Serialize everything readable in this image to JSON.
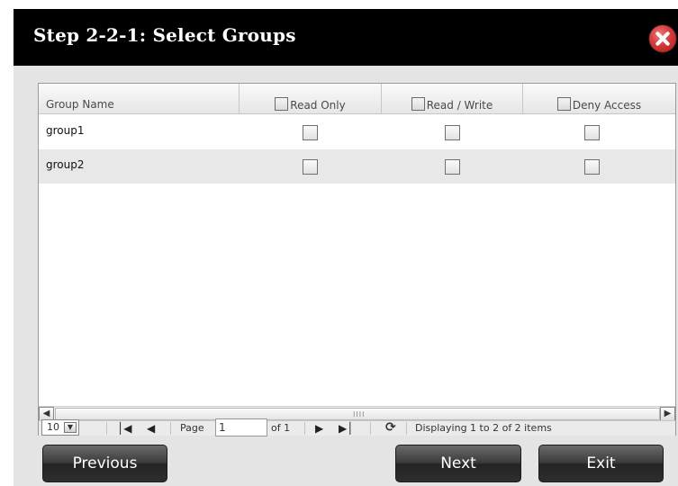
{
  "dialog": {
    "title": "Step 2-2-1: Select Groups"
  },
  "grid": {
    "columns": [
      "Group Name",
      "Read Only",
      "Read / Write",
      "Deny Access"
    ],
    "rows": [
      {
        "name": "group1",
        "read_only": false,
        "read_write": false,
        "deny_access": false
      },
      {
        "name": "group2",
        "read_only": false,
        "read_write": false,
        "deny_access": false
      }
    ],
    "scroll_grip": "IIII"
  },
  "pager": {
    "page_size": "10",
    "page_label": "Page",
    "page_value": "1",
    "of_label": "of 1",
    "status": "Displaying 1 to 2 of 2 items"
  },
  "buttons": {
    "previous": "Previous",
    "next": "Next",
    "exit": "Exit"
  },
  "colors": {
    "titlebar": "#000000",
    "close_button": "#d23a3a",
    "button_bg": "#2e2e2e"
  }
}
